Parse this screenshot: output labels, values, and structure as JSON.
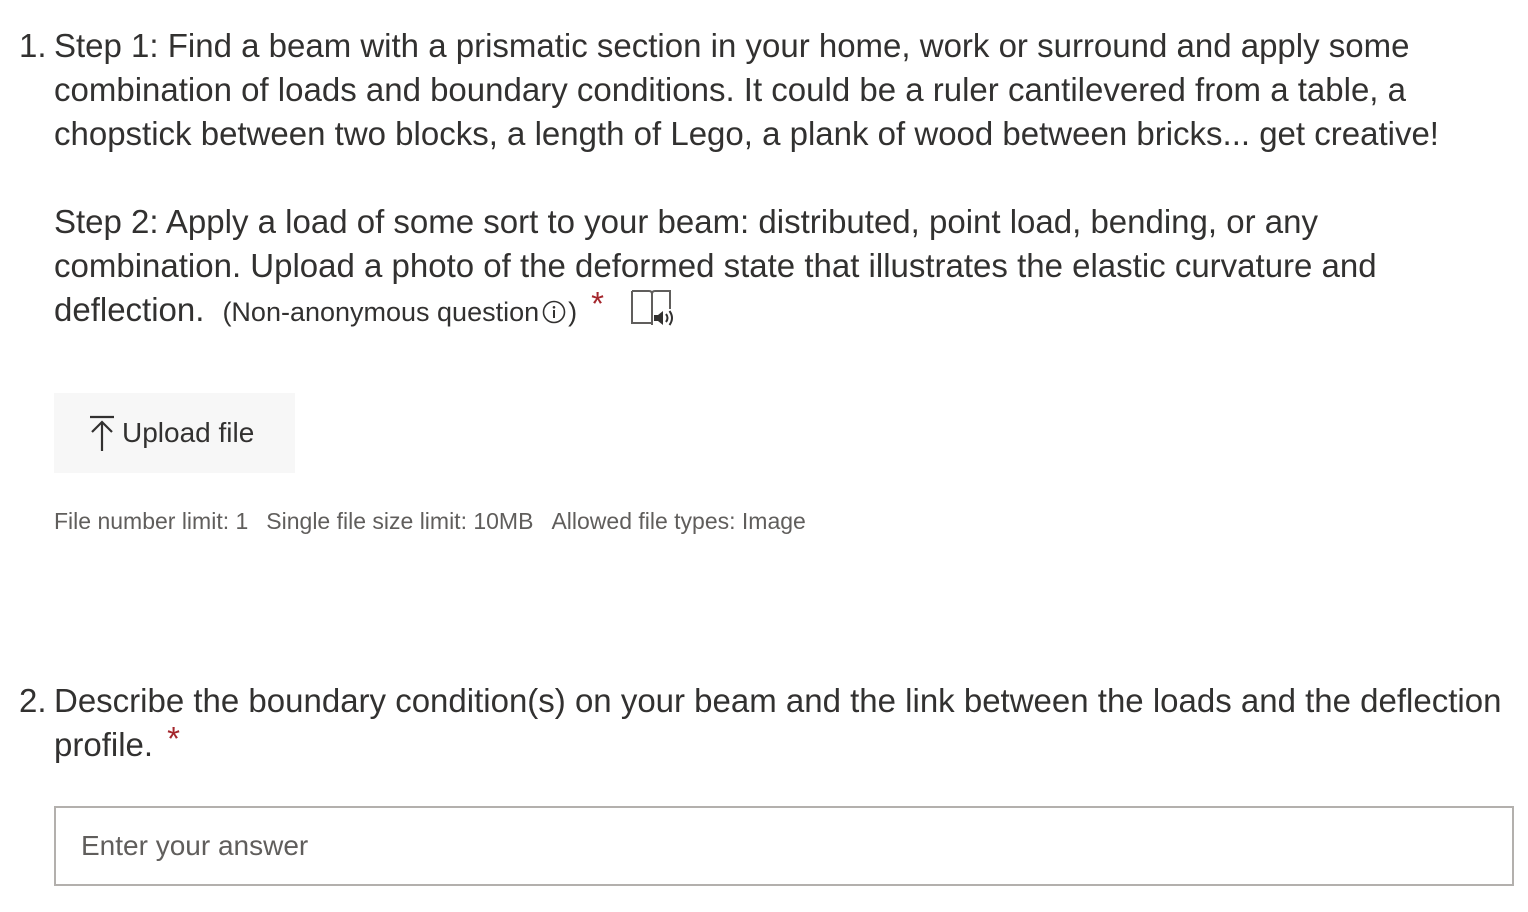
{
  "questions": [
    {
      "number": "1.",
      "step1": "Step 1: Find a beam with a prismatic section in your home, work or surround and apply some combination of loads and boundary conditions. It could be a ruler cantilevered from a table, a chopstick between two blocks, a length of Lego, a plank of wood between bricks... get creative!",
      "step2": "Step 2: Apply a load of some sort to your beam: distributed, point load, bending, or any combination. Upload a photo of the deformed state that illustrates the elastic curvature and deflection.",
      "meta_open": "(Non-anonymous question",
      "meta_close": ")",
      "required_mark": "*",
      "info_icon": "info-icon",
      "reader_icon": "immersive-reader-icon",
      "upload": {
        "label": "Upload file",
        "icon": "upload-arrow-icon"
      },
      "limits": {
        "file_number": "File number limit: 1",
        "file_size": "Single file size limit: 10MB",
        "file_types": "Allowed file types: Image"
      }
    },
    {
      "number": "2.",
      "text": "Describe the boundary condition(s) on your beam and the link between the loads and the deflection profile.",
      "required_mark": "*",
      "answer_placeholder": "Enter your answer",
      "answer_value": ""
    }
  ],
  "colors": {
    "text": "#323130",
    "secondary_text": "#605e5c",
    "required": "#a4262c",
    "button_bg": "#f7f7f7",
    "input_border": "#b3b0ad"
  }
}
